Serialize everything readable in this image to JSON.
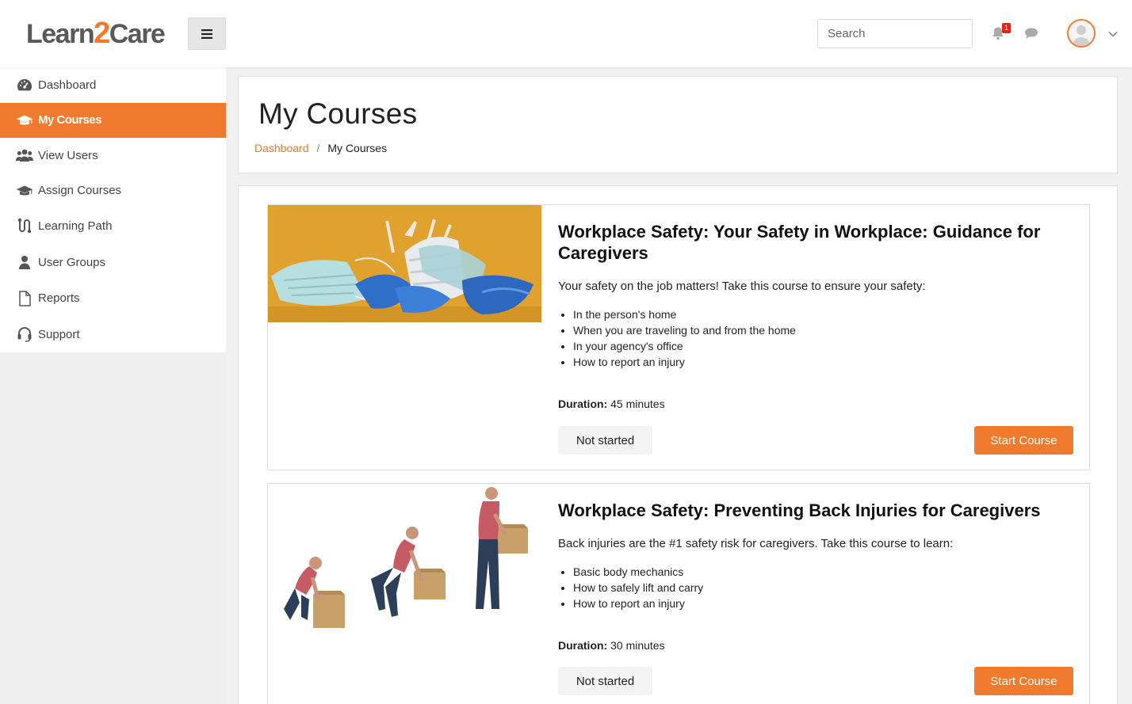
{
  "brand": {
    "name_part1": "Learn",
    "name_part2": "2",
    "name_part3": "Care",
    "accent": "#f07a2d"
  },
  "header": {
    "search_placeholder": "Search",
    "notification_count": "1",
    "icons": [
      "bars-icon",
      "bell-icon",
      "chat-icon",
      "user-avatar-icon",
      "chevron-down-icon"
    ]
  },
  "sidebar": {
    "items": [
      {
        "label": "Dashboard",
        "icon": "dashboard-icon",
        "active": false
      },
      {
        "label": "My Courses",
        "icon": "graduation-cap-icon",
        "active": true
      },
      {
        "label": "View Users",
        "icon": "users-icon",
        "active": false
      },
      {
        "label": "Assign Courses",
        "icon": "graduation-cap-icon",
        "active": false
      },
      {
        "label": "Learning Path",
        "icon": "route-icon",
        "active": false
      },
      {
        "label": "User Groups",
        "icon": "user-icon",
        "active": false
      },
      {
        "label": "Reports",
        "icon": "file-icon",
        "active": false
      },
      {
        "label": "Support",
        "icon": "headset-icon",
        "active": false
      }
    ]
  },
  "page": {
    "title": "My Courses",
    "breadcrumb": {
      "link": "Dashboard",
      "separator": "/",
      "current": "My Courses"
    }
  },
  "courses": [
    {
      "title": "Workplace Safety: Your Safety in Workplace: Guidance for Caregivers",
      "description": "Your safety on the job matters! Take this course to ensure your safety:",
      "bullets": [
        "In the person's home",
        "When you are traveling to and from the home",
        "In your agency's office",
        "How to report an injury"
      ],
      "duration_label": "Duration:",
      "duration_value": "45 minutes",
      "status": "Not started",
      "action": "Start Course"
    },
    {
      "title": "Workplace Safety: Preventing Back Injuries for Caregivers",
      "description": "Back injuries are the #1 safety risk for caregivers. Take this course to learn:",
      "bullets": [
        "Basic body mechanics",
        "How to safely lift and carry",
        "How to report an injury"
      ],
      "duration_label": "Duration:",
      "duration_value": "30 minutes",
      "status": "Not started",
      "action": "Start Course"
    }
  ]
}
